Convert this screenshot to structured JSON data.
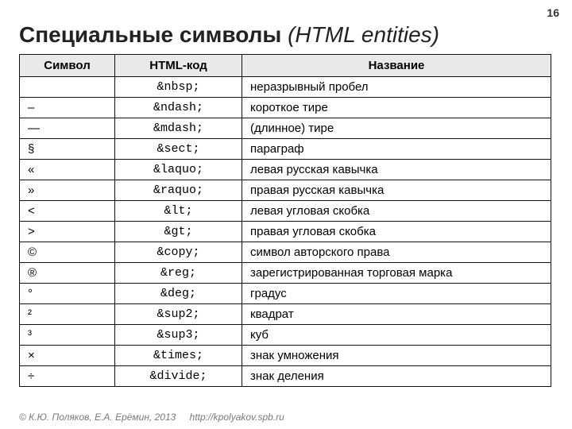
{
  "page_number": "16",
  "title": {
    "main": "Специальные символы",
    "subtitle": "(HTML entities)"
  },
  "headers": {
    "symbol": "Символ",
    "code": "HTML-код",
    "name": "Название"
  },
  "rows": [
    {
      "symbol": " ",
      "code": "&nbsp;",
      "name": "неразрывный пробел"
    },
    {
      "symbol": "–",
      "code": "&ndash;",
      "name": "короткое тире"
    },
    {
      "symbol": "—",
      "code": "&mdash;",
      "name": "(длинное) тире"
    },
    {
      "symbol": "§",
      "code": "&sect;",
      "name": "параграф"
    },
    {
      "symbol": "«",
      "code": "&laquo;",
      "name": "левая русская кавычка"
    },
    {
      "symbol": "»",
      "code": "&raquo;",
      "name": "правая русская кавычка"
    },
    {
      "symbol": "<",
      "code": "&lt;",
      "name": "левая угловая скобка"
    },
    {
      "symbol": ">",
      "code": "&gt;",
      "name": "правая угловая скобка"
    },
    {
      "symbol": "©",
      "code": "&copy;",
      "name": "символ авторского права"
    },
    {
      "symbol": "®",
      "code": "&reg;",
      "name": "зарегистрированная торговая марка"
    },
    {
      "symbol": "°",
      "code": "&deg;",
      "name": "градус"
    },
    {
      "symbol": "²",
      "code": "&sup2;",
      "name": "квадрат"
    },
    {
      "symbol": "³",
      "code": "&sup3;",
      "name": "куб"
    },
    {
      "symbol": "×",
      "code": "&times;",
      "name": "знак умножения"
    },
    {
      "symbol": "÷",
      "code": "&divide;",
      "name": "знак деления"
    }
  ],
  "footer": {
    "copyright": "© К.Ю. Поляков, Е.А. Ерёмин, 2013",
    "url": "http://kpolyakov.spb.ru"
  }
}
